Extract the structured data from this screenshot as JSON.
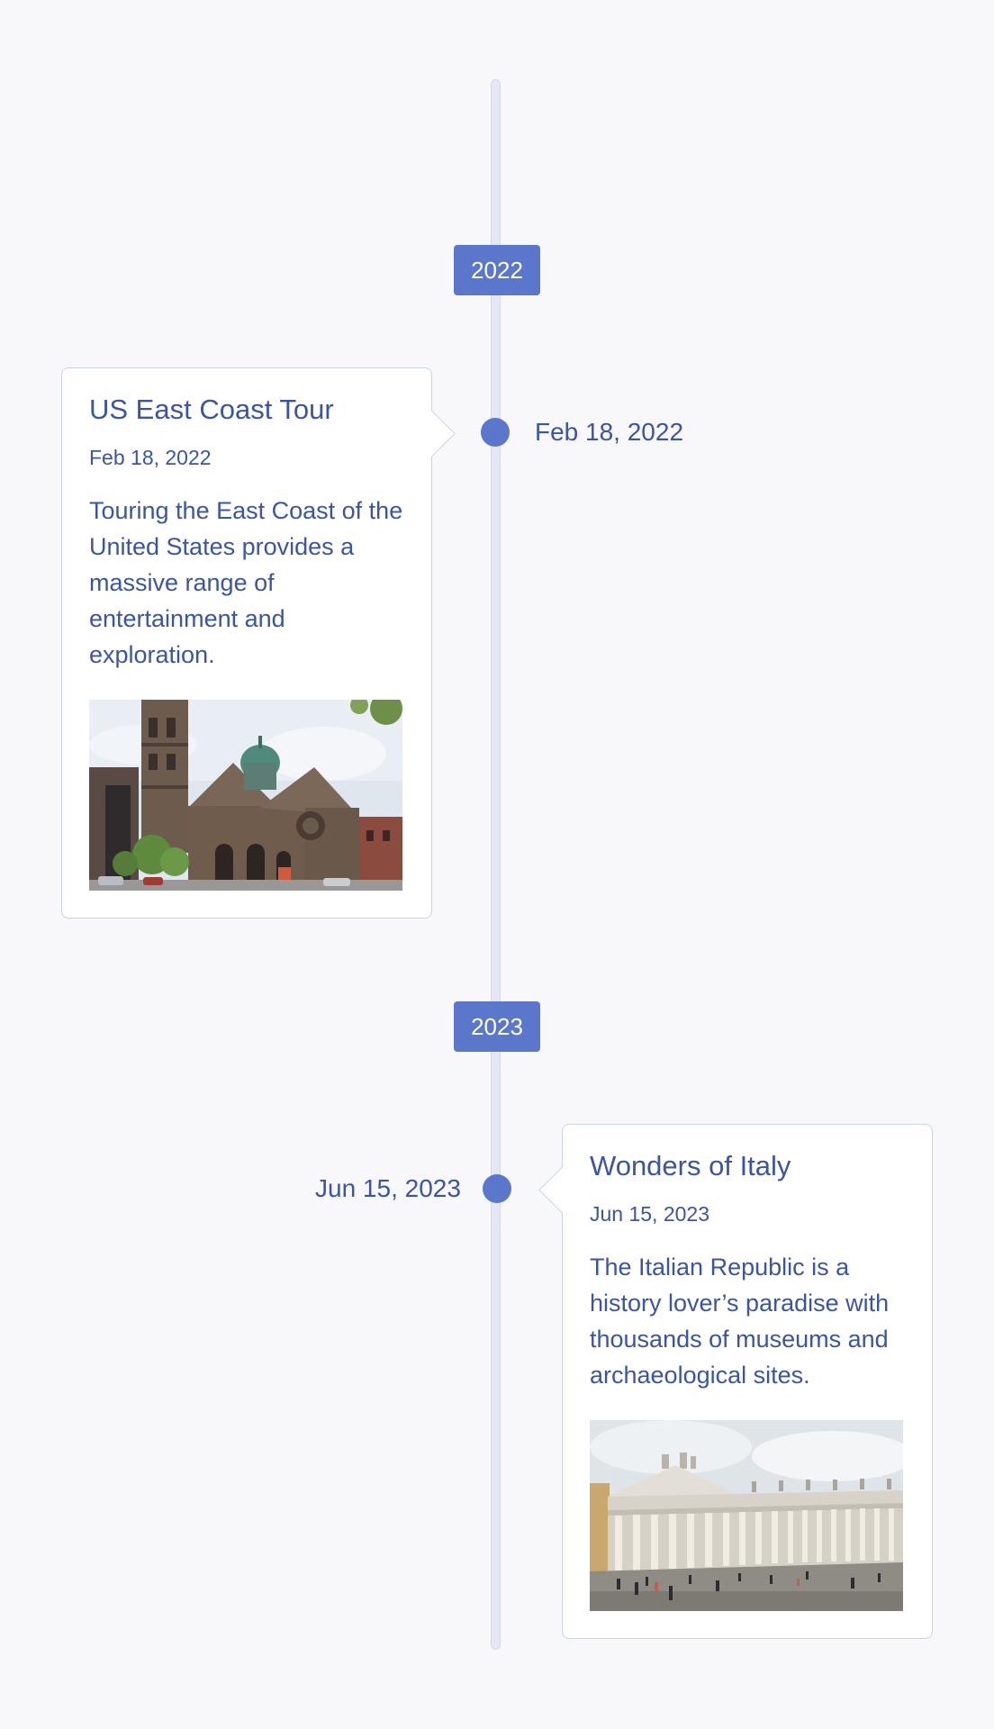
{
  "timeline": {
    "years": [
      "2022",
      "2023"
    ],
    "events": [
      {
        "side_date": "Feb 18, 2022",
        "title": "US East Coast Tour",
        "date": "Feb 18, 2022",
        "text": "Touring the East Coast of the United States provides a massive range of entertainment and exploration.",
        "image": "church-photo"
      },
      {
        "side_date": "Jun 15, 2023",
        "title": "Wonders of Italy",
        "date": "Jun 15, 2023",
        "text": "The Italian Republic is a history lover’s paradise with thousands of museums and archaeological sites.",
        "image": "colonnade-photo"
      }
    ]
  },
  "colors": {
    "accent": "#5a77cc",
    "text": "#3a55a8",
    "background": "#f8f8fb",
    "card_border": "#c9d3ea"
  }
}
